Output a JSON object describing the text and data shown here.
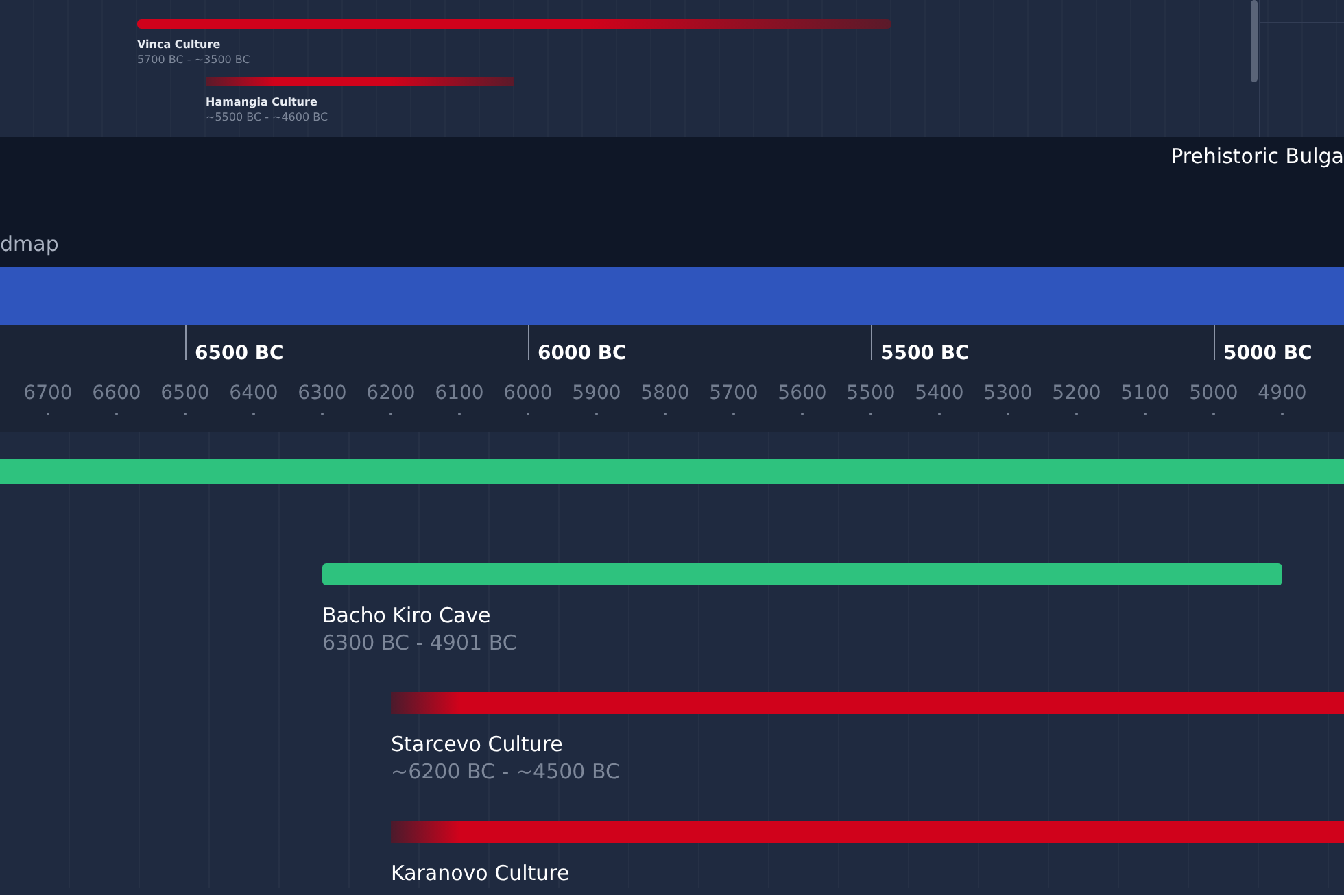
{
  "background_timeline": {
    "items": [
      {
        "name": "Vinca Culture",
        "dates": "5700 BC - ~3500 BC",
        "color": "#d0021b",
        "fuzzy_start": false,
        "fuzzy_end": true
      },
      {
        "name": "Hamangia Culture",
        "dates": "~5500 BC - ~4600 BC",
        "color": "#d0021b",
        "fuzzy_start": true,
        "fuzzy_end": true
      }
    ]
  },
  "header": {
    "title": "Prehistoric Bulga",
    "subtitle": "dmap"
  },
  "axis": {
    "major": [
      "6500 BC",
      "6000 BC",
      "5500 BC",
      "5000 BC"
    ],
    "minor": [
      "6700",
      "6600",
      "6500",
      "6400",
      "6300",
      "6200",
      "6100",
      "6000",
      "5900",
      "5800",
      "5700",
      "5600",
      "5500",
      "5400",
      "5300",
      "5200",
      "5100",
      "5000",
      "4900"
    ]
  },
  "items": [
    {
      "name": "Bacho Kiro Cave",
      "dates": "6300 BC - 4901 BC",
      "color": "#2ec27e",
      "fuzzy_start": false,
      "fuzzy_end": false
    },
    {
      "name": "Starcevo Culture",
      "dates": "~6200 BC - ~4500 BC",
      "color": "#d0021b",
      "fuzzy_start": true,
      "fuzzy_end": false
    },
    {
      "name": "Karanovo Culture",
      "color": "#d0021b",
      "fuzzy_start": true,
      "fuzzy_end": false
    }
  ]
}
